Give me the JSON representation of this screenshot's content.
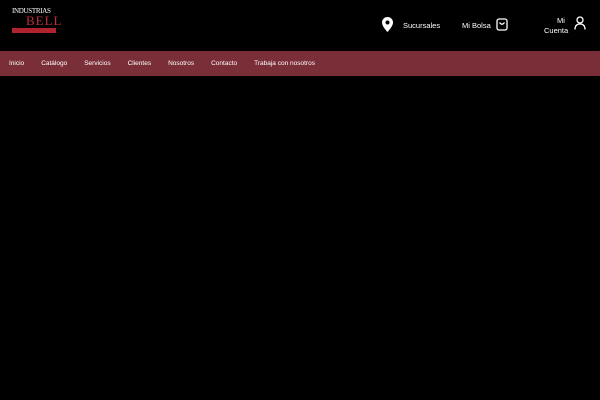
{
  "logo": {
    "text": "INDUSTRIAS",
    "brand": "BELL"
  },
  "header": {
    "branches": "Sucursales",
    "bag": "Mi Bolsa",
    "account_line1": "Mi",
    "account_line2": "Cuenta"
  },
  "nav": [
    "Inicio",
    "Catálogo",
    "Servicios",
    "Clientes",
    "Nosotros",
    "Contacto",
    "Trabaja con nosotros"
  ],
  "colors": {
    "nav_bg": "#7a2e38"
  }
}
